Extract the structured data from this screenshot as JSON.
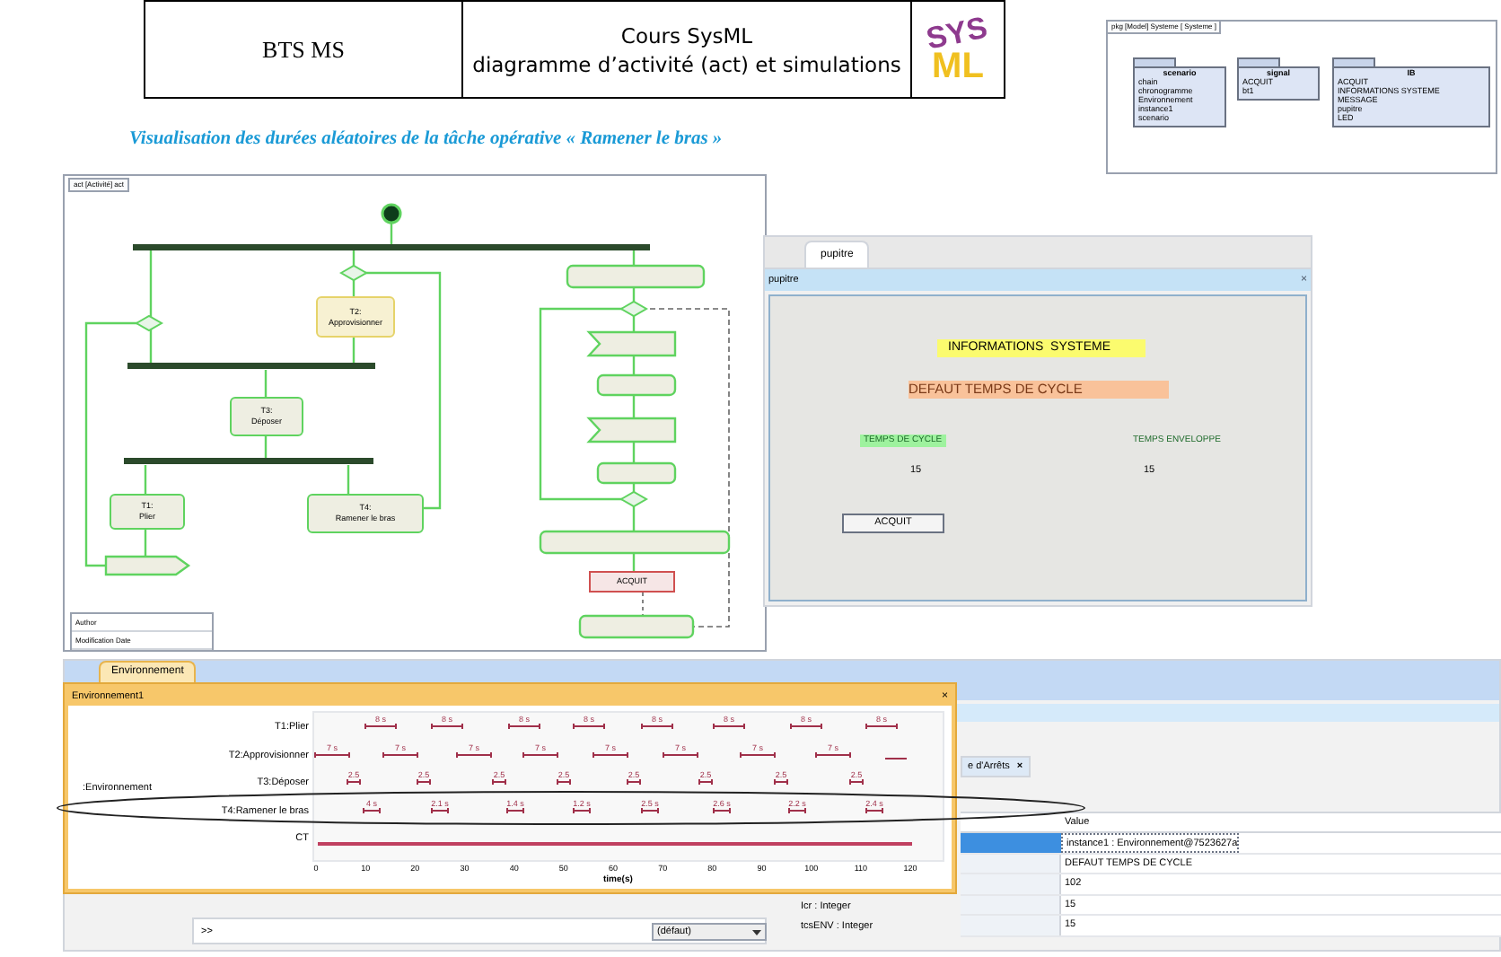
{
  "header": {
    "left": "BTS MS",
    "title_lines": [
      "Cours SysML",
      "diagramme d’activité (act) et simulations"
    ],
    "logo": {
      "top": "SYS",
      "bottom": "ML"
    }
  },
  "package_diagram": {
    "tab": "pkg [Model] Systeme [ Systeme ]",
    "packages": [
      {
        "name": "scenario",
        "items": [
          "chain",
          "chronogramme",
          "Environnement",
          "instance1",
          "scenario"
        ]
      },
      {
        "name": "signal",
        "items": [
          "ACQUIT",
          "bt1"
        ]
      },
      {
        "name": "IB",
        "items": [
          "ACQUIT",
          "INFORMATIONS SYSTEME",
          "MESSAGE",
          "pupitre",
          "LED"
        ]
      }
    ]
  },
  "subtitle": "Visualisation des durées aléatoires de la tâche opérative « Ramener le bras »",
  "activity_diagram": {
    "tab": "act [Activité] act",
    "actions": [
      {
        "title": "T2:",
        "name": "Approvisionner",
        "highlighted": true
      },
      {
        "title": "T3:",
        "name": "Déposer",
        "highlighted": false
      },
      {
        "title": "T1:",
        "name": "Plier",
        "highlighted": false
      },
      {
        "title": "T4:",
        "name": "Ramener le bras",
        "highlighted": false
      }
    ],
    "signal": "ACQUIT",
    "footer": [
      "Author",
      "Modification Date"
    ]
  },
  "pupitre": {
    "tab": "pupitre",
    "title": "pupitre",
    "close": "×",
    "info": "INFORMATIONS  SYSTEME",
    "message": "DEFAUT TEMPS DE CYCLE",
    "fields": [
      {
        "label": "TEMPS DE CYCLE",
        "value": "15"
      },
      {
        "label": "TEMPS ENVELOPPE",
        "value": "15"
      }
    ],
    "button": "ACQUIT"
  },
  "timeline": {
    "tab": "Environnement",
    "title": "Environnement1",
    "close": "×",
    "lifeline": ":Environnement",
    "rows": [
      {
        "name": "T1:Plier",
        "labels": [
          "8 s",
          "8 s",
          "8 s",
          "8 s",
          "8 s",
          "8 s",
          "8 s",
          "8 s"
        ]
      },
      {
        "name": "T2:Approvisionner",
        "labels": [
          "7 s",
          "7 s",
          "7 s",
          "7 s",
          "7 s",
          "7 s",
          "7 s",
          "7 s"
        ]
      },
      {
        "name": "T3:Déposer",
        "labels": [
          "2.5",
          "2.5",
          "2.5",
          "2.5",
          "2.5",
          "2.5",
          "2.5",
          "2.5"
        ]
      },
      {
        "name": "T4:Ramener le bras",
        "labels": [
          "4 s",
          "2.1 s",
          "1.4 s",
          "1.2 s",
          "2.5 s",
          "2.6 s",
          "2.2 s",
          "2.4 s"
        ]
      },
      {
        "name": "CT"
      }
    ],
    "ticks": [
      "0",
      "10",
      "20",
      "30",
      "40",
      "50",
      "60",
      "70",
      "80",
      "90",
      "100",
      "110",
      "120"
    ],
    "xlabel": "time(s)"
  },
  "properties": {
    "tab": "e d'Arrêts",
    "close": "×",
    "column": "Value",
    "rows": [
      {
        "value": "instance1 : Environnement@7523627a",
        "selected": true
      },
      {
        "value": "DEFAUT TEMPS DE CYCLE",
        "selected": false
      },
      {
        "value": "102",
        "selected": false
      },
      {
        "value": "15",
        "selected": false
      },
      {
        "value": "15",
        "selected": false
      }
    ],
    "tree": [
      "Icr : Integer",
      "tcsENV : Integer"
    ]
  },
  "console": {
    "prompt": ">>",
    "dropdown": "(défaut)"
  }
}
